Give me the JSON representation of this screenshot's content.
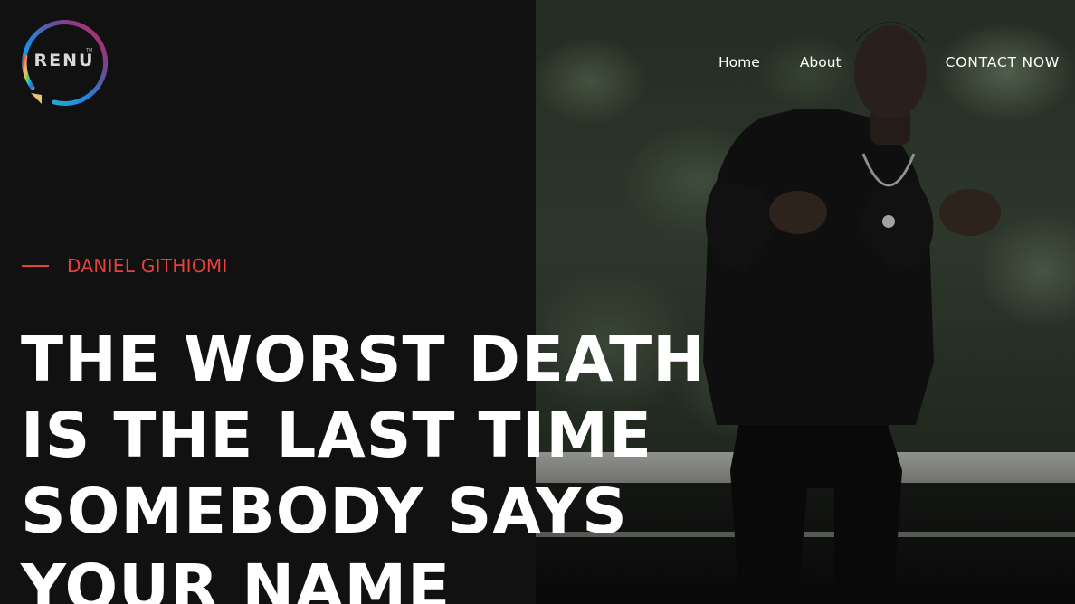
{
  "brand": {
    "logo_text": "RENU",
    "logo_tm": "TM",
    "ring_colors": [
      "#e63946",
      "#f4a261",
      "#e9c46a",
      "#8ac926",
      "#2ec4b6",
      "#1e88e5",
      "#6a4c93",
      "#d81b60"
    ]
  },
  "nav": {
    "items": [
      {
        "label": "Home"
      },
      {
        "label": "About"
      },
      {
        "label": "CONTACT NOW"
      }
    ]
  },
  "hero": {
    "author": "DANIEL GITHIOMI",
    "headline_lines": [
      "THE WORST DEATH",
      "IS THE LAST TIME",
      "SOMEBODY SAYS",
      "YOUR NAME"
    ],
    "accent_color": "#e8403a",
    "background_color": "#111112",
    "photo_subject": "man-seated-on-bench"
  }
}
